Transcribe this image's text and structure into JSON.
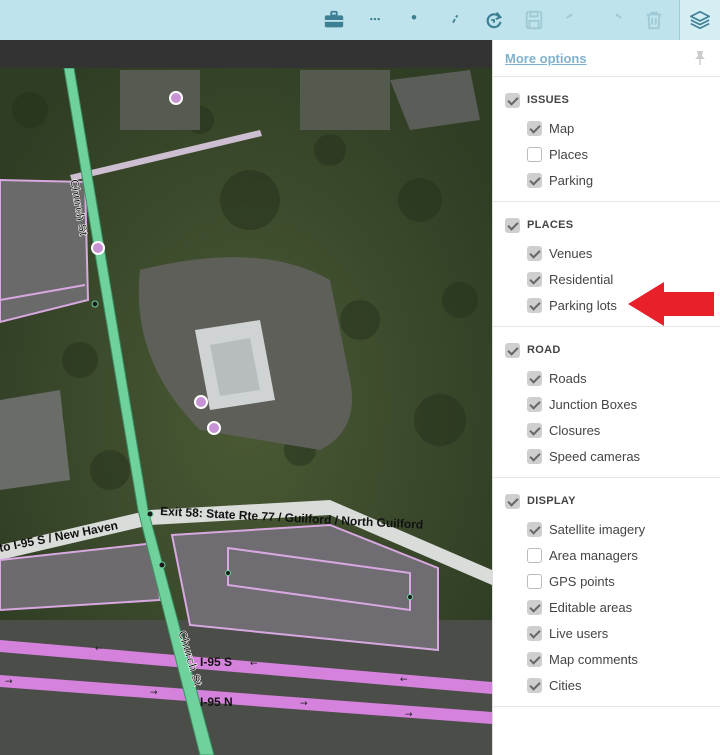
{
  "toolbar": {
    "buttons": [
      {
        "name": "briefcase-icon",
        "color": "#3d7f93",
        "enabled": true
      },
      {
        "name": "chat-icon",
        "color": "#3d7f93",
        "enabled": true
      },
      {
        "name": "map-pin-icon",
        "color": "#3d7f93",
        "enabled": true
      },
      {
        "name": "road-icon",
        "color": "#3d7f93",
        "enabled": true
      },
      {
        "name": "redo-circle-icon",
        "color": "#3d7f93",
        "enabled": true
      },
      {
        "name": "save-icon",
        "color": "#9fc9d4",
        "enabled": false
      },
      {
        "name": "undo-icon",
        "color": "#9fc9d4",
        "enabled": false
      },
      {
        "name": "redo-icon",
        "color": "#9fc9d4",
        "enabled": false
      },
      {
        "name": "trash-icon",
        "color": "#9fc9d4",
        "enabled": false
      }
    ],
    "layers_icon": "layers-icon"
  },
  "panel": {
    "more_options": "More options",
    "groups": [
      {
        "title": "ISSUES",
        "checked": true,
        "items": [
          {
            "label": "Map",
            "checked": true
          },
          {
            "label": "Places",
            "checked": false
          },
          {
            "label": "Parking",
            "checked": true
          }
        ]
      },
      {
        "title": "PLACES",
        "checked": true,
        "items": [
          {
            "label": "Venues",
            "checked": true
          },
          {
            "label": "Residential",
            "checked": true
          },
          {
            "label": "Parking lots",
            "checked": true
          }
        ]
      },
      {
        "title": "ROAD",
        "checked": true,
        "items": [
          {
            "label": "Roads",
            "checked": true
          },
          {
            "label": "Junction Boxes",
            "checked": true
          },
          {
            "label": "Closures",
            "checked": true
          },
          {
            "label": "Speed cameras",
            "checked": true
          }
        ]
      },
      {
        "title": "DISPLAY",
        "checked": true,
        "items": [
          {
            "label": "Satellite imagery",
            "checked": true
          },
          {
            "label": "Area managers",
            "checked": false
          },
          {
            "label": "GPS points",
            "checked": false
          },
          {
            "label": "Editable areas",
            "checked": true
          },
          {
            "label": "Live users",
            "checked": true
          },
          {
            "label": "Map comments",
            "checked": true
          },
          {
            "label": "Cities",
            "checked": true
          }
        ]
      }
    ]
  },
  "map": {
    "labels": {
      "church_st_top": "Church St",
      "church_st_bottom": "Church St",
      "exit_ramp": "Exit 58: State Rte 77 / Guilford / North Guilford",
      "ramp_left": "to I-95 S / New Haven",
      "i95s": "I-95 S",
      "i95n": "I-95 N"
    }
  },
  "annotation": {
    "arrow_color": "#e8202a"
  }
}
